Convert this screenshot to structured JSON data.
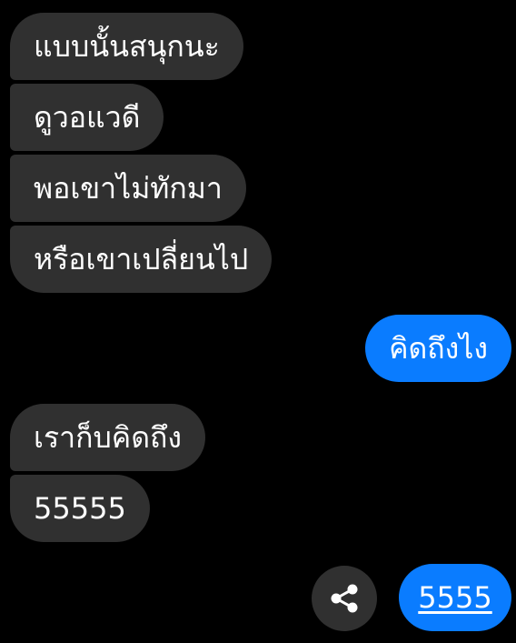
{
  "colors": {
    "background": "#000000",
    "incoming_bubble": "#303030",
    "outgoing_bubble": "#0a7cff",
    "text": "#ffffff"
  },
  "messages": [
    {
      "direction": "incoming",
      "text": "แบบนั้นสนุกนะ"
    },
    {
      "direction": "incoming",
      "text": "ดูวอแวดี"
    },
    {
      "direction": "incoming",
      "text": "พอเขาไม่ทักมา"
    },
    {
      "direction": "incoming",
      "text": "หรือเขาเปลี่ยนไป"
    },
    {
      "direction": "outgoing",
      "text": "คิดถึงไง"
    },
    {
      "direction": "incoming",
      "text": "เราก็บคิดถึง"
    },
    {
      "direction": "incoming",
      "text": "55555"
    },
    {
      "direction": "outgoing",
      "text": "5555",
      "is_link": true
    }
  ],
  "share_button": {
    "icon": "share-icon"
  }
}
